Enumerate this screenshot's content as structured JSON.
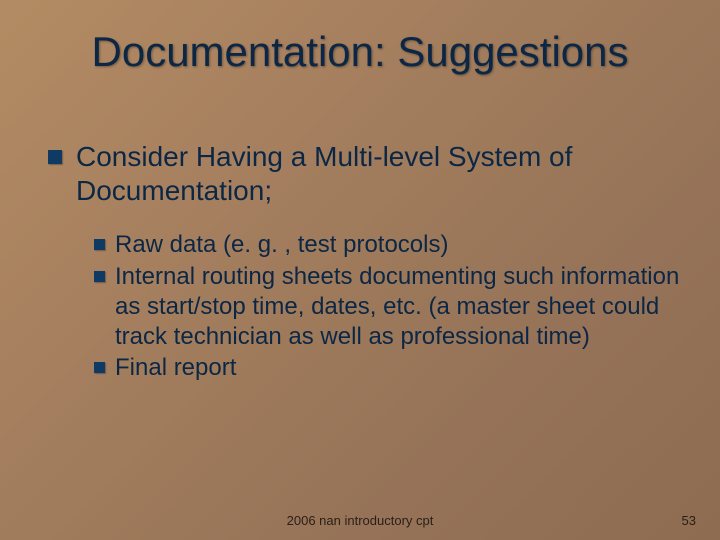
{
  "title": "Documentation: Suggestions",
  "body": {
    "lvl1": "Consider Having a Multi-level System of Documentation;",
    "lvl2": [
      "Raw data (e. g. , test protocols)",
      "Internal routing sheets documenting such information as start/stop time, dates, etc. (a master sheet could track technician as well as professional time)",
      "Final report"
    ]
  },
  "footer": {
    "center": "2006 nan introductory cpt",
    "page": "53"
  },
  "colors": {
    "title": "#0c2745",
    "bullet": "#0e3a63"
  }
}
